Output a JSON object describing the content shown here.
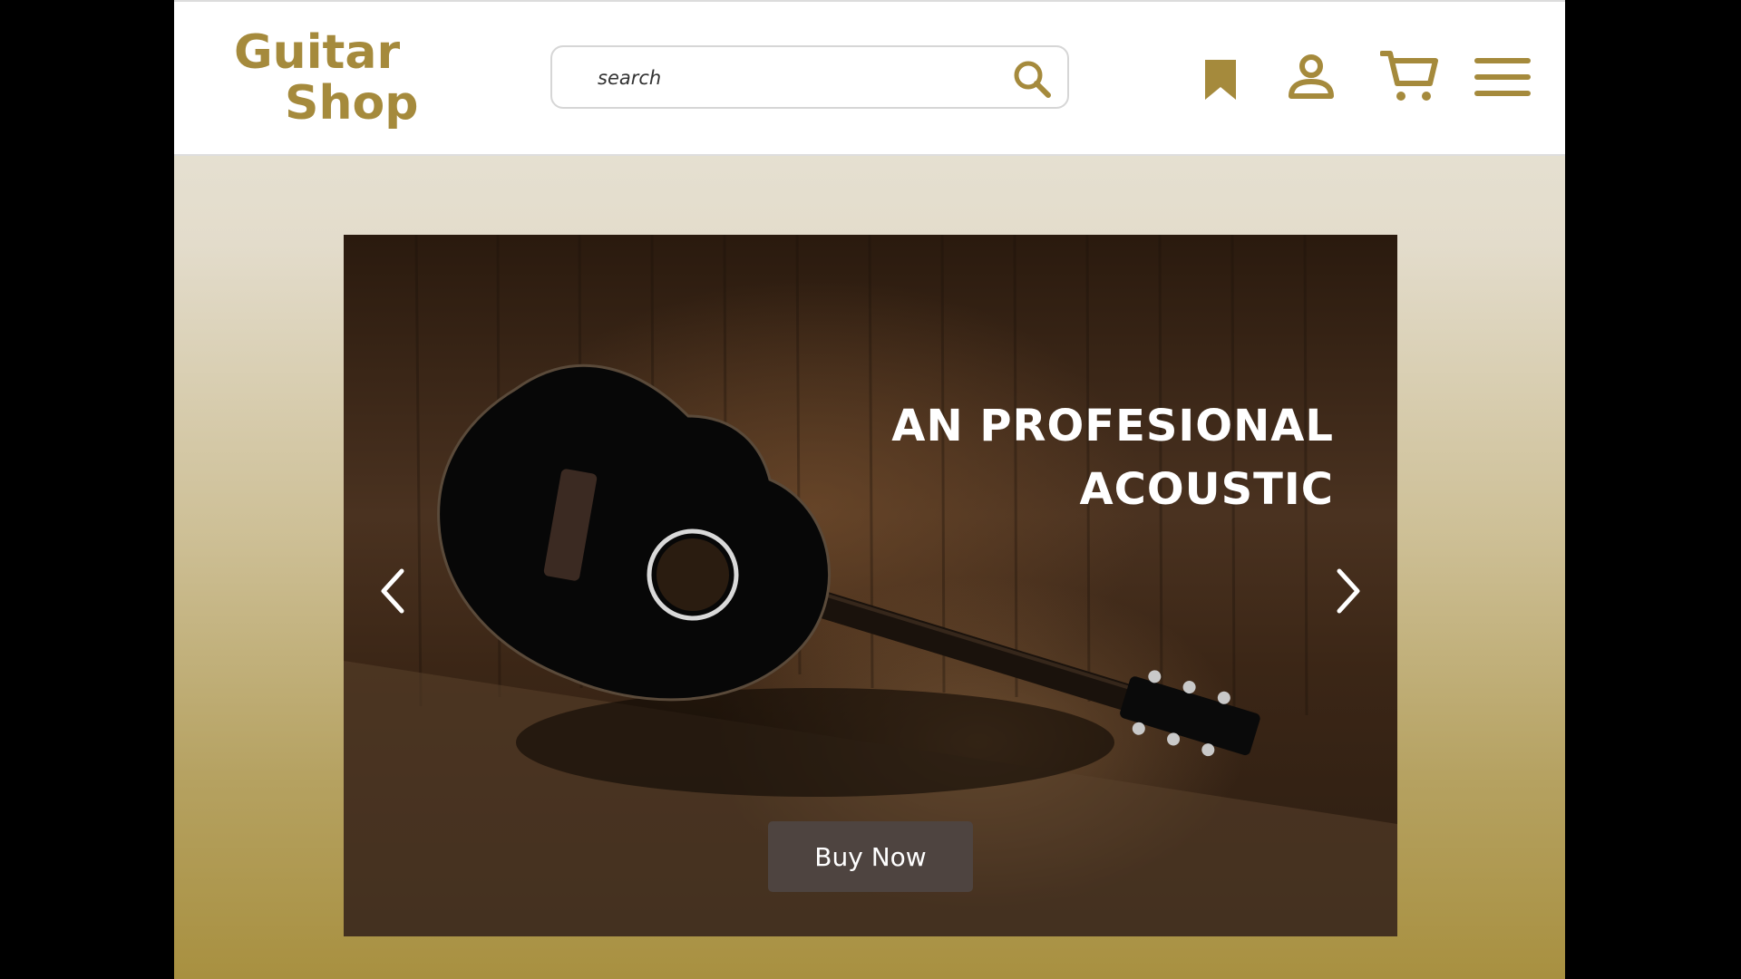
{
  "brand": {
    "line1": "Guitar",
    "line2": "Shop",
    "color": "#a58a3c"
  },
  "search": {
    "placeholder": "search",
    "icon": "search-icon"
  },
  "header_icons": [
    "bookmark-icon",
    "user-icon",
    "cart-icon",
    "menu-icon"
  ],
  "hero": {
    "title_line1": "AN PROFESIONAL",
    "title_line2": "ACOUSTIC",
    "button_label": "Buy Now",
    "image": "acoustic-guitar-photo",
    "prev_icon": "chevron-left-icon",
    "next_icon": "chevron-right-icon"
  },
  "colors": {
    "accent": "#a58a3c",
    "button_bg": "#4e4440",
    "page_bg_top": "#e9e6da",
    "page_bg_bottom": "#a89040"
  }
}
